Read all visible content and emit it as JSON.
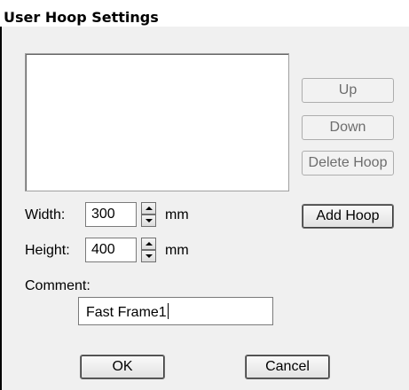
{
  "window": {
    "title": "User Hoop Settings"
  },
  "buttons": {
    "up": "Up",
    "down": "Down",
    "delete_hoop": "Delete Hoop",
    "add_hoop": "Add Hoop",
    "ok": "OK",
    "cancel": "Cancel"
  },
  "fields": {
    "width_label": "Width:",
    "width_value": "300",
    "width_unit": "mm",
    "height_label": "Height:",
    "height_value": "400",
    "height_unit": "mm",
    "comment_label": "Comment:",
    "comment_value": "Fast Frame1"
  },
  "colors": {
    "dialog_bg": "#f0f0f0",
    "disabled_text": "#6d6d6d"
  }
}
